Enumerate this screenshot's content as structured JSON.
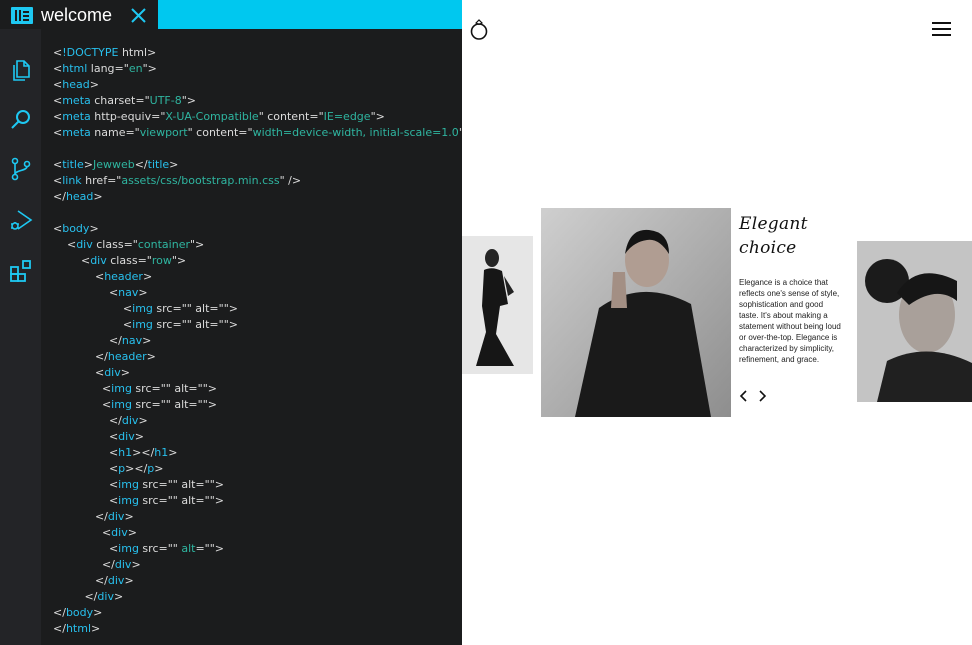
{
  "editor": {
    "tab_title": "welcome",
    "icons": [
      "explorer-icon",
      "search-icon",
      "source-control-icon",
      "run-debug-icon",
      "extensions-icon",
      "close-icon"
    ],
    "accent": "#00c8ef",
    "code_lines": [
      [
        {
          "t": "p",
          "v": "<"
        },
        {
          "t": "k",
          "v": "!DOCTYPE"
        },
        {
          "t": "p",
          "v": " html>"
        }
      ],
      [
        {
          "t": "p",
          "v": "<"
        },
        {
          "t": "k",
          "v": "html"
        },
        {
          "t": "p",
          "v": " lang=\""
        },
        {
          "t": "s",
          "v": "en"
        },
        {
          "t": "p",
          "v": "\">"
        }
      ],
      [
        {
          "t": "p",
          "v": "<"
        },
        {
          "t": "k",
          "v": "head"
        },
        {
          "t": "p",
          "v": ">"
        }
      ],
      [
        {
          "t": "p",
          "v": "<"
        },
        {
          "t": "k",
          "v": "meta"
        },
        {
          "t": "p",
          "v": " charset=\""
        },
        {
          "t": "s",
          "v": "UTF-8"
        },
        {
          "t": "p",
          "v": "\">"
        }
      ],
      [
        {
          "t": "p",
          "v": "<"
        },
        {
          "t": "k",
          "v": "meta"
        },
        {
          "t": "p",
          "v": " http-equiv=\""
        },
        {
          "t": "s",
          "v": "X-UA-Compatible"
        },
        {
          "t": "p",
          "v": "\" content=\""
        },
        {
          "t": "s",
          "v": "IE=edge"
        },
        {
          "t": "p",
          "v": "\">"
        }
      ],
      [
        {
          "t": "p",
          "v": "<"
        },
        {
          "t": "k",
          "v": "meta"
        },
        {
          "t": "p",
          "v": " name=\""
        },
        {
          "t": "s",
          "v": "viewport"
        },
        {
          "t": "p",
          "v": "\" content=\""
        },
        {
          "t": "s",
          "v": "width=device-width, initial-scale=1.0"
        },
        {
          "t": "p",
          "v": "\">"
        }
      ],
      [],
      [
        {
          "t": "p",
          "v": "<"
        },
        {
          "t": "k",
          "v": "title"
        },
        {
          "t": "p",
          "v": ">"
        },
        {
          "t": "s",
          "v": "Jewweb"
        },
        {
          "t": "p",
          "v": "</"
        },
        {
          "t": "k",
          "v": "title"
        },
        {
          "t": "p",
          "v": ">"
        }
      ],
      [
        {
          "t": "p",
          "v": "<"
        },
        {
          "t": "k",
          "v": "link"
        },
        {
          "t": "p",
          "v": " href=\""
        },
        {
          "t": "s",
          "v": "assets/css/bootstrap.min.css"
        },
        {
          "t": "p",
          "v": "\" />"
        }
      ],
      [
        {
          "t": "p",
          "v": "</"
        },
        {
          "t": "k",
          "v": "head"
        },
        {
          "t": "p",
          "v": ">"
        }
      ],
      [],
      [
        {
          "t": "p",
          "v": "<"
        },
        {
          "t": "k",
          "v": "body"
        },
        {
          "t": "p",
          "v": ">"
        }
      ],
      [
        {
          "t": "p",
          "v": "    <"
        },
        {
          "t": "k",
          "v": "div"
        },
        {
          "t": "p",
          "v": " class=\""
        },
        {
          "t": "s",
          "v": "container"
        },
        {
          "t": "p",
          "v": "\">"
        }
      ],
      [
        {
          "t": "p",
          "v": "        <"
        },
        {
          "t": "k",
          "v": "div"
        },
        {
          "t": "p",
          "v": " class=\""
        },
        {
          "t": "s",
          "v": "row"
        },
        {
          "t": "p",
          "v": "\">"
        }
      ],
      [
        {
          "t": "p",
          "v": "            <"
        },
        {
          "t": "k",
          "v": "header"
        },
        {
          "t": "p",
          "v": ">"
        }
      ],
      [
        {
          "t": "p",
          "v": "                <"
        },
        {
          "t": "k",
          "v": "nav"
        },
        {
          "t": "p",
          "v": ">"
        }
      ],
      [
        {
          "t": "p",
          "v": "                    <"
        },
        {
          "t": "k",
          "v": "img"
        },
        {
          "t": "p",
          "v": " src=\"\" alt=\"\">"
        }
      ],
      [
        {
          "t": "p",
          "v": "                    <"
        },
        {
          "t": "k",
          "v": "img"
        },
        {
          "t": "p",
          "v": " src=\"\" alt=\"\">"
        }
      ],
      [
        {
          "t": "p",
          "v": "                </"
        },
        {
          "t": "k",
          "v": "nav"
        },
        {
          "t": "p",
          "v": ">"
        }
      ],
      [
        {
          "t": "p",
          "v": "            </"
        },
        {
          "t": "k",
          "v": "header"
        },
        {
          "t": "p",
          "v": ">"
        }
      ],
      [
        {
          "t": "p",
          "v": "            <"
        },
        {
          "t": "k",
          "v": "div"
        },
        {
          "t": "p",
          "v": ">"
        }
      ],
      [
        {
          "t": "p",
          "v": "              <"
        },
        {
          "t": "k",
          "v": "img"
        },
        {
          "t": "p",
          "v": " src=\"\" alt=\"\">"
        }
      ],
      [
        {
          "t": "p",
          "v": "              <"
        },
        {
          "t": "k",
          "v": "img"
        },
        {
          "t": "p",
          "v": " src=\"\" alt=\"\">"
        }
      ],
      [
        {
          "t": "p",
          "v": "                </"
        },
        {
          "t": "k",
          "v": "div"
        },
        {
          "t": "p",
          "v": ">"
        }
      ],
      [
        {
          "t": "p",
          "v": "                <"
        },
        {
          "t": "k",
          "v": "div"
        },
        {
          "t": "p",
          "v": ">"
        }
      ],
      [
        {
          "t": "p",
          "v": "                <"
        },
        {
          "t": "k",
          "v": "h1"
        },
        {
          "t": "p",
          "v": "></"
        },
        {
          "t": "k",
          "v": "h1"
        },
        {
          "t": "p",
          "v": ">"
        }
      ],
      [
        {
          "t": "p",
          "v": "                <"
        },
        {
          "t": "k",
          "v": "p"
        },
        {
          "t": "p",
          "v": "></"
        },
        {
          "t": "k",
          "v": "p"
        },
        {
          "t": "p",
          "v": ">"
        }
      ],
      [
        {
          "t": "p",
          "v": "                <"
        },
        {
          "t": "k",
          "v": "img"
        },
        {
          "t": "p",
          "v": " src=\"\" alt=\"\">"
        }
      ],
      [
        {
          "t": "p",
          "v": "                <"
        },
        {
          "t": "k",
          "v": "img"
        },
        {
          "t": "p",
          "v": " src=\"\" alt=\"\">"
        }
      ],
      [
        {
          "t": "p",
          "v": "            </"
        },
        {
          "t": "k",
          "v": "div"
        },
        {
          "t": "p",
          "v": ">"
        }
      ],
      [
        {
          "t": "p",
          "v": "              <"
        },
        {
          "t": "k",
          "v": "div"
        },
        {
          "t": "p",
          "v": ">"
        }
      ],
      [
        {
          "t": "p",
          "v": "                <"
        },
        {
          "t": "k",
          "v": "img"
        },
        {
          "t": "p",
          "v": " src=\"\" "
        },
        {
          "t": "s",
          "v": "alt"
        },
        {
          "t": "p",
          "v": "=\"\">"
        }
      ],
      [
        {
          "t": "p",
          "v": "              </"
        },
        {
          "t": "k",
          "v": "div"
        },
        {
          "t": "p",
          "v": ">"
        }
      ],
      [
        {
          "t": "p",
          "v": "            </"
        },
        {
          "t": "k",
          "v": "div"
        },
        {
          "t": "p",
          "v": ">"
        }
      ],
      [
        {
          "t": "p",
          "v": "         </"
        },
        {
          "t": "k",
          "v": "div"
        },
        {
          "t": "p",
          "v": ">"
        }
      ],
      [
        {
          "t": "p",
          "v": "</"
        },
        {
          "t": "k",
          "v": "body"
        },
        {
          "t": "p",
          "v": ">"
        }
      ],
      [
        {
          "t": "p",
          "v": "</"
        },
        {
          "t": "k",
          "v": "html"
        },
        {
          "t": "p",
          "v": ">"
        }
      ]
    ]
  },
  "preview": {
    "heading": "Elegant choice",
    "paragraph": "Elegance is a choice that reflects one's sense of style, sophistication and good taste. It's about making a statement without being loud or over-the-top. Elegance is characterized by simplicity, refinement, and grace.",
    "icons": [
      "ring-logo-icon",
      "hamburger-menu-icon",
      "chevron-left-icon",
      "chevron-right-icon"
    ]
  }
}
